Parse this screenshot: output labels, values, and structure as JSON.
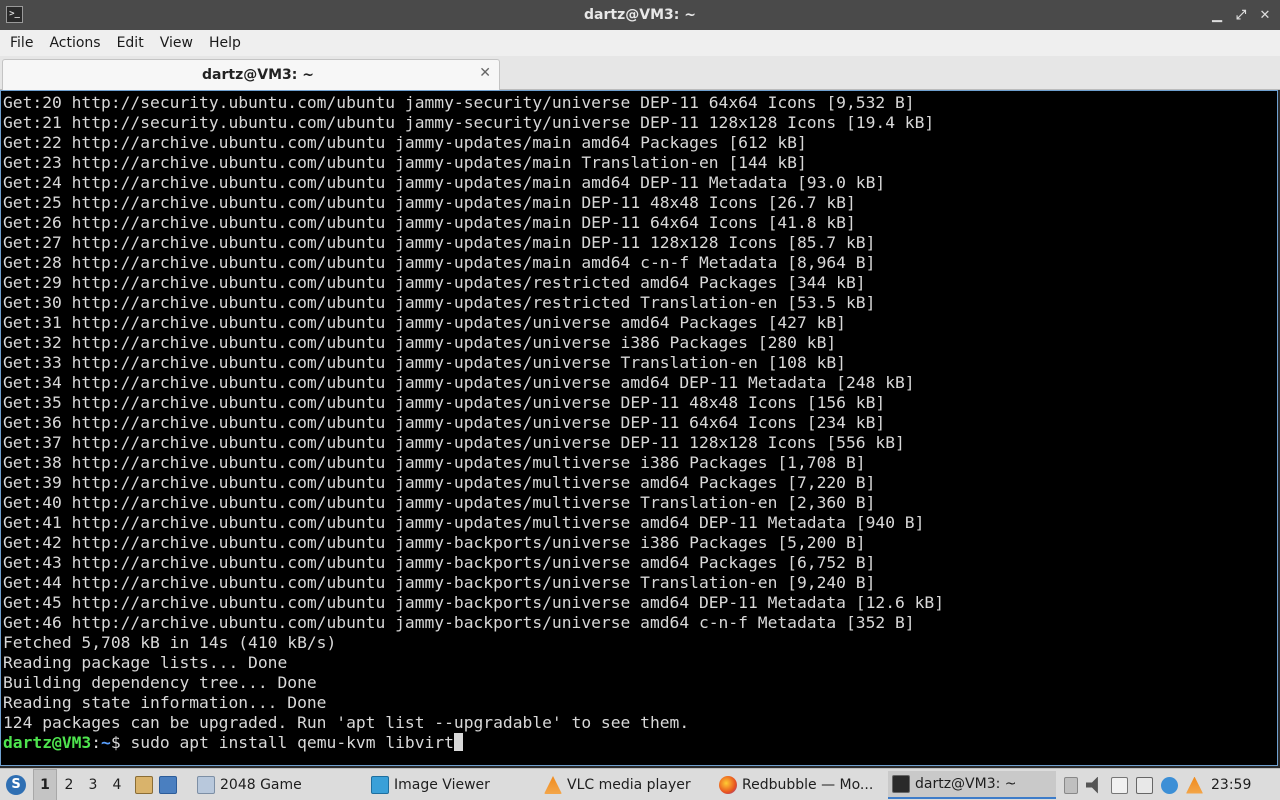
{
  "window": {
    "title": "dartz@VM3: ~",
    "controls": {
      "minimize": "▁",
      "restore": "⤢",
      "close": "✕"
    }
  },
  "menu": {
    "items": [
      "File",
      "Actions",
      "Edit",
      "View",
      "Help"
    ]
  },
  "tab": {
    "label": "dartz@VM3: ~",
    "close": "✕"
  },
  "terminal": {
    "lines": [
      "Get:20 http://security.ubuntu.com/ubuntu jammy-security/universe DEP-11 64x64 Icons [9,532 B]",
      "Get:21 http://security.ubuntu.com/ubuntu jammy-security/universe DEP-11 128x128 Icons [19.4 kB]",
      "Get:22 http://archive.ubuntu.com/ubuntu jammy-updates/main amd64 Packages [612 kB]",
      "Get:23 http://archive.ubuntu.com/ubuntu jammy-updates/main Translation-en [144 kB]",
      "Get:24 http://archive.ubuntu.com/ubuntu jammy-updates/main amd64 DEP-11 Metadata [93.0 kB]",
      "Get:25 http://archive.ubuntu.com/ubuntu jammy-updates/main DEP-11 48x48 Icons [26.7 kB]",
      "Get:26 http://archive.ubuntu.com/ubuntu jammy-updates/main DEP-11 64x64 Icons [41.8 kB]",
      "Get:27 http://archive.ubuntu.com/ubuntu jammy-updates/main DEP-11 128x128 Icons [85.7 kB]",
      "Get:28 http://archive.ubuntu.com/ubuntu jammy-updates/main amd64 c-n-f Metadata [8,964 B]",
      "Get:29 http://archive.ubuntu.com/ubuntu jammy-updates/restricted amd64 Packages [344 kB]",
      "Get:30 http://archive.ubuntu.com/ubuntu jammy-updates/restricted Translation-en [53.5 kB]",
      "Get:31 http://archive.ubuntu.com/ubuntu jammy-updates/universe amd64 Packages [427 kB]",
      "Get:32 http://archive.ubuntu.com/ubuntu jammy-updates/universe i386 Packages [280 kB]",
      "Get:33 http://archive.ubuntu.com/ubuntu jammy-updates/universe Translation-en [108 kB]",
      "Get:34 http://archive.ubuntu.com/ubuntu jammy-updates/universe amd64 DEP-11 Metadata [248 kB]",
      "Get:35 http://archive.ubuntu.com/ubuntu jammy-updates/universe DEP-11 48x48 Icons [156 kB]",
      "Get:36 http://archive.ubuntu.com/ubuntu jammy-updates/universe DEP-11 64x64 Icons [234 kB]",
      "Get:37 http://archive.ubuntu.com/ubuntu jammy-updates/universe DEP-11 128x128 Icons [556 kB]",
      "Get:38 http://archive.ubuntu.com/ubuntu jammy-updates/multiverse i386 Packages [1,708 B]",
      "Get:39 http://archive.ubuntu.com/ubuntu jammy-updates/multiverse amd64 Packages [7,220 B]",
      "Get:40 http://archive.ubuntu.com/ubuntu jammy-updates/multiverse Translation-en [2,360 B]",
      "Get:41 http://archive.ubuntu.com/ubuntu jammy-updates/multiverse amd64 DEP-11 Metadata [940 B]",
      "Get:42 http://archive.ubuntu.com/ubuntu jammy-backports/universe i386 Packages [5,200 B]",
      "Get:43 http://archive.ubuntu.com/ubuntu jammy-backports/universe amd64 Packages [6,752 B]",
      "Get:44 http://archive.ubuntu.com/ubuntu jammy-backports/universe Translation-en [9,240 B]",
      "Get:45 http://archive.ubuntu.com/ubuntu jammy-backports/universe amd64 DEP-11 Metadata [12.6 kB]",
      "Get:46 http://archive.ubuntu.com/ubuntu jammy-backports/universe amd64 c-n-f Metadata [352 B]",
      "Fetched 5,708 kB in 14s (410 kB/s)",
      "Reading package lists... Done",
      "Building dependency tree... Done",
      "Reading state information... Done",
      "124 packages can be upgraded. Run 'apt list --upgradable' to see them."
    ],
    "prompt": {
      "user_host": "dartz@VM3",
      "colon": ":",
      "path": "~",
      "symbol": "$ ",
      "command": "sudo apt install qemu-kvm libvirt"
    }
  },
  "taskbar": {
    "start_icon": "start-menu-icon",
    "workspaces": [
      "1",
      "2",
      "3",
      "4"
    ],
    "active_workspace": "1",
    "tasks": [
      {
        "label": "2048 Game",
        "icon": "window-icon"
      },
      {
        "label": "Image Viewer",
        "icon": "image-viewer-icon"
      },
      {
        "label": "VLC media player",
        "icon": "vlc-icon"
      },
      {
        "label": "Redbubble — Mo...",
        "icon": "firefox-icon"
      },
      {
        "label": "dartz@VM3: ~",
        "icon": "terminal-icon"
      }
    ],
    "clock": "23:59",
    "colors": {
      "accent": "#3d7cc9",
      "prompt_user": "#4ee44e",
      "prompt_path": "#5aa0ff"
    }
  }
}
